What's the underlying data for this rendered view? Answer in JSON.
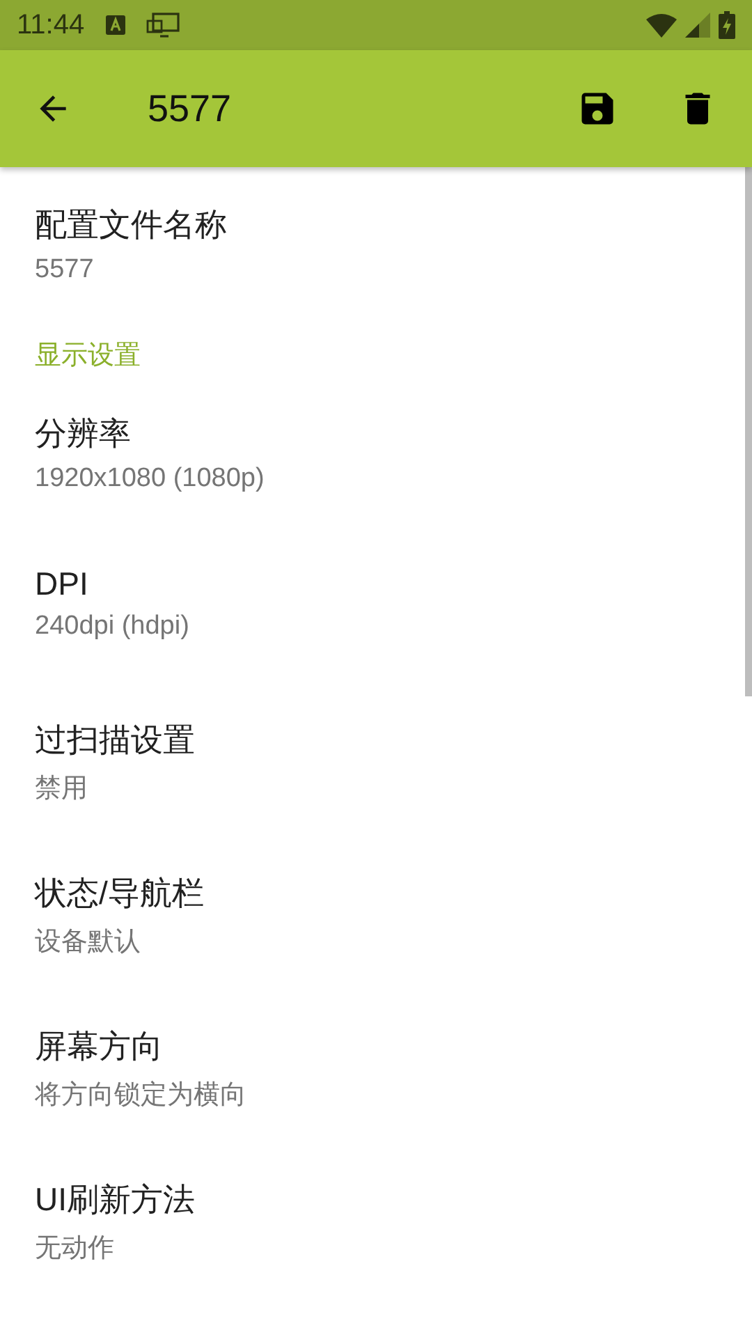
{
  "status_bar": {
    "time": "11:44"
  },
  "toolbar": {
    "title": "5577"
  },
  "items": [
    {
      "kind": "preference",
      "title": "配置文件名称",
      "summary": "5577"
    },
    {
      "kind": "category",
      "title": "显示设置"
    },
    {
      "kind": "preference",
      "title": "分辨率",
      "summary": "1920x1080 (1080p)"
    },
    {
      "kind": "preference",
      "title": "DPI",
      "summary": "240dpi (hdpi)"
    },
    {
      "kind": "preference",
      "title": "过扫描设置",
      "summary": "禁用"
    },
    {
      "kind": "preference",
      "title": "状态/导航栏",
      "summary": "设备默认"
    },
    {
      "kind": "preference",
      "title": "屏幕方向",
      "summary": "将方向锁定为横向"
    },
    {
      "kind": "preference",
      "title": "UI刷新方法",
      "summary": "无动作"
    }
  ]
}
